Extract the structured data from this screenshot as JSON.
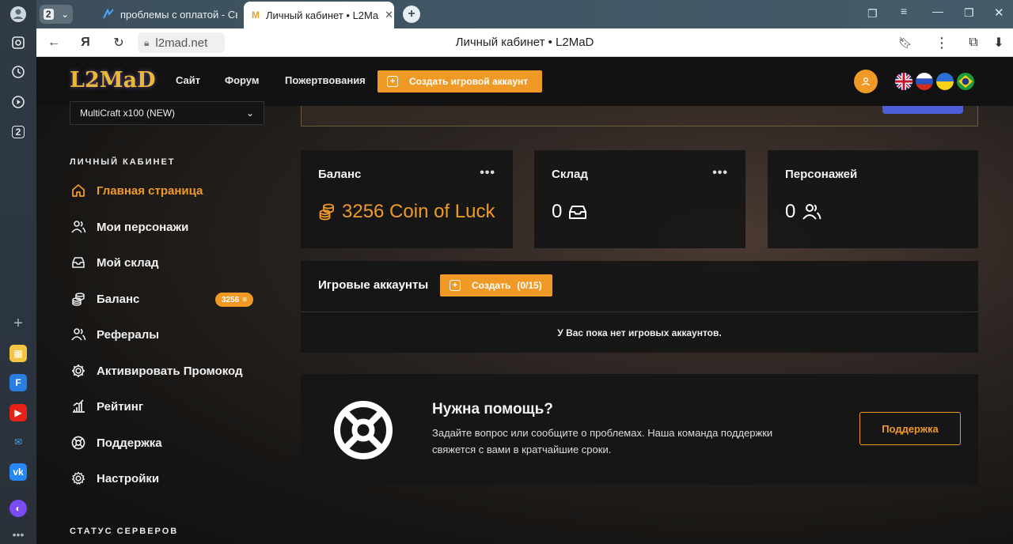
{
  "browser": {
    "tab_count": "2",
    "tabs": [
      {
        "title": "проблемы с оплатой - Св",
        "active": false
      },
      {
        "title": "Личный кабинет • L2Ma",
        "active": true
      }
    ],
    "url": "l2mad.net",
    "page_title": "Личный кабинет • L2MaD",
    "rail_counter": "2"
  },
  "site": {
    "logo": "L2MaD",
    "nav": [
      "Сайт",
      "Форум",
      "Пожертвования"
    ],
    "create_account_label": "Создать игровой аккаунт",
    "accent": "#ef9a26"
  },
  "sidebar": {
    "server": "MultiCraft x100 (NEW)",
    "section_title": "ЛИЧНЫЙ КАБИНЕТ",
    "items": [
      {
        "label": "Главная страница",
        "icon": "home-icon"
      },
      {
        "label": "Мои персонажи",
        "icon": "users-icon"
      },
      {
        "label": "Мой склад",
        "icon": "inbox-icon"
      },
      {
        "label": "Баланс",
        "icon": "coins-icon"
      },
      {
        "label": "Рефералы",
        "icon": "users-icon"
      },
      {
        "label": "Активировать Промокод",
        "icon": "gear-icon"
      },
      {
        "label": "Рейтинг",
        "icon": "chart-icon"
      },
      {
        "label": "Поддержка",
        "icon": "lifebuoy-icon"
      },
      {
        "label": "Настройки",
        "icon": "settings-icon"
      }
    ],
    "balance_badge": "3256",
    "status_title": "СТАТУС СЕРВЕРОВ"
  },
  "cards": {
    "balance": {
      "title": "Баланс",
      "value": "3256 Coin of Luck"
    },
    "warehouse": {
      "title": "Склад",
      "value": "0"
    },
    "characters": {
      "title": "Персонажей",
      "value": "0"
    }
  },
  "accounts": {
    "title": "Игровые аккаунты",
    "create_label": "Создать",
    "count": "(0/15)",
    "empty_text": "У Вас пока нет игровых аккаунтов."
  },
  "help": {
    "title": "Нужна помощь?",
    "description": "Задайте вопрос или сообщите о проблемах. Наша команда поддержки свяжется с вами в кратчайшие сроки.",
    "button": "Поддержка"
  }
}
